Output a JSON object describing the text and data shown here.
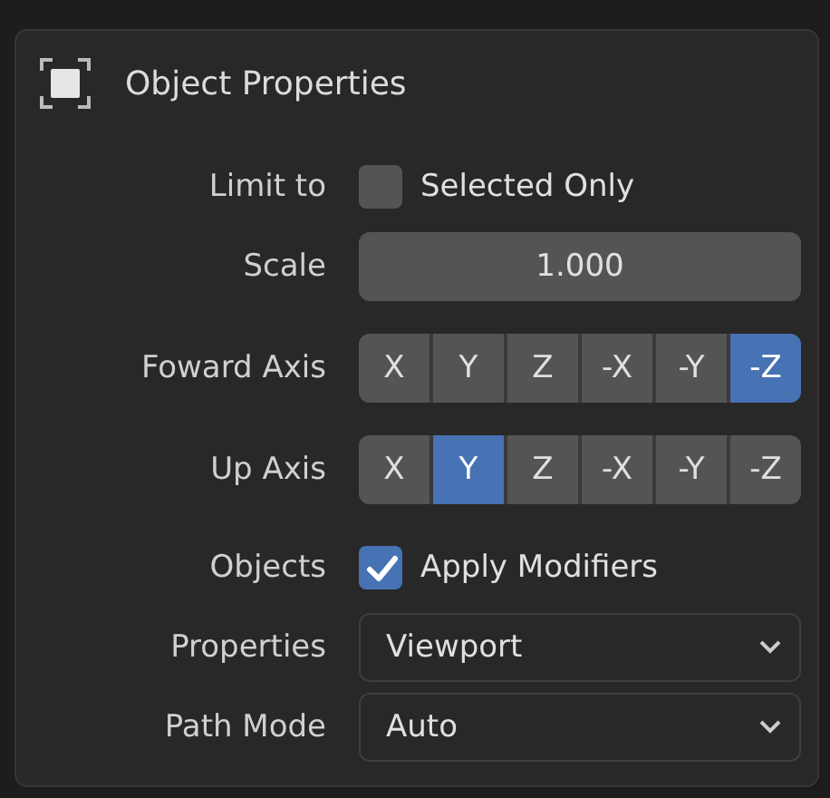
{
  "panel": {
    "title": "Object Properties"
  },
  "sections": [
    {
      "rows": [
        {
          "kind": "checkbox",
          "label": "Limit to",
          "text": "Selected Only",
          "checked": false
        },
        {
          "kind": "number",
          "label": "Scale",
          "value": "1.000"
        },
        {
          "kind": "enum",
          "label": "Foward Axis",
          "options": [
            {
              "label": "X",
              "selected": false
            },
            {
              "label": "Y",
              "selected": false
            },
            {
              "label": "Z",
              "selected": false
            },
            {
              "label": "-X",
              "selected": false
            },
            {
              "label": "-Y",
              "selected": false
            },
            {
              "label": "-Z",
              "selected": true
            }
          ]
        },
        {
          "kind": "enum",
          "label": "Up Axis",
          "options": [
            {
              "label": "X",
              "selected": false
            },
            {
              "label": "Y",
              "selected": true
            },
            {
              "label": "Z",
              "selected": false
            },
            {
              "label": "-X",
              "selected": false
            },
            {
              "label": "-Y",
              "selected": false
            },
            {
              "label": "-Z",
              "selected": false
            }
          ]
        }
      ]
    },
    {
      "rows": [
        {
          "kind": "checkbox",
          "label": "Objects",
          "text": "Apply Modifiers",
          "checked": true
        },
        {
          "kind": "dropdown",
          "label": "Properties",
          "value": "Viewport"
        },
        {
          "kind": "dropdown",
          "label": "Path Mode",
          "value": "Auto"
        }
      ]
    }
  ]
}
